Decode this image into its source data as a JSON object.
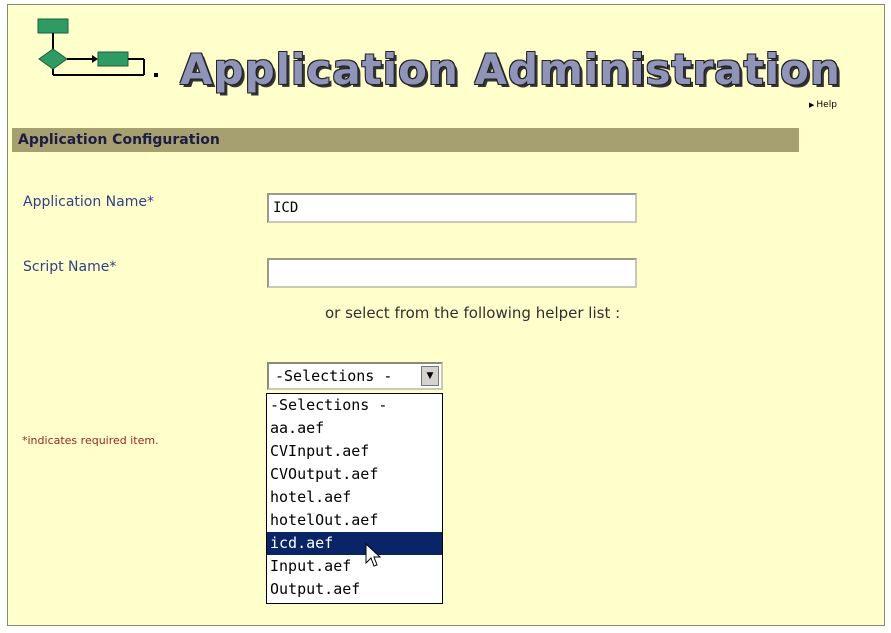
{
  "header": {
    "title": "Application Administration",
    "help_label": "Help",
    "logo_icon": "workflow-logo-icon"
  },
  "section": {
    "title": "Application Configuration"
  },
  "form": {
    "app_name_label": "Application Name*",
    "app_name_value": "ICD",
    "script_name_label": "Script Name*",
    "script_name_value": "",
    "helper_text": "or select from the following helper list :",
    "select_value": "-Selections -",
    "required_note": "*indicates required item."
  },
  "dropdown": {
    "options": [
      "-Selections -",
      "aa.aef",
      "CVInput.aef",
      "CVOutput.aef",
      "hotel.aef",
      "hotelOut.aef",
      "icd.aef",
      "Input.aef",
      "Output.aef"
    ],
    "highlighted": "icd.aef"
  },
  "colors": {
    "page_background": "#ffffcc",
    "section_bar": "#a6a070",
    "label_text": "#303f8a",
    "highlight": "#0a2468",
    "logo_green": "#2e9a64",
    "required_note": "#9b2525"
  }
}
